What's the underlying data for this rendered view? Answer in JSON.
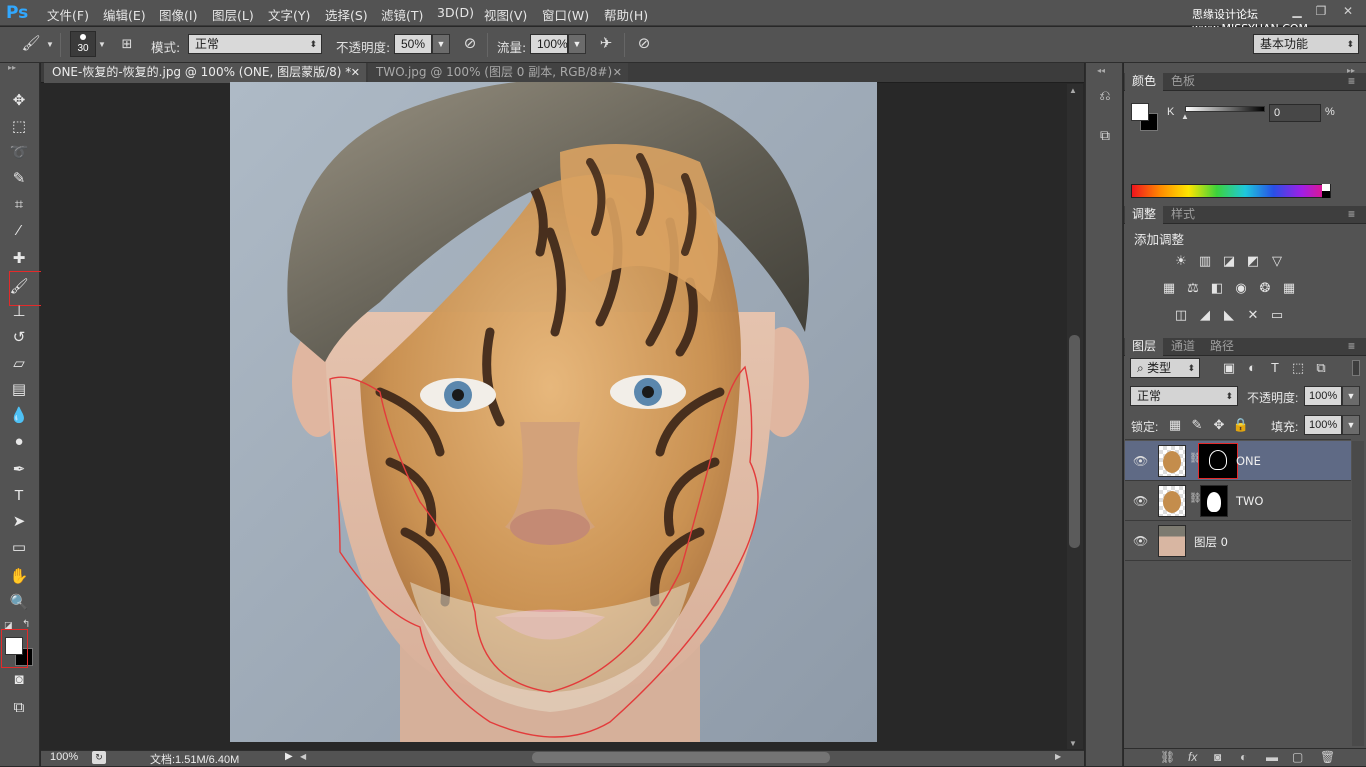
{
  "app": {
    "logo": "Ps"
  },
  "menu": [
    {
      "label": "文件(F)"
    },
    {
      "label": "编辑(E)"
    },
    {
      "label": "图像(I)"
    },
    {
      "label": "图层(L)"
    },
    {
      "label": "文字(Y)"
    },
    {
      "label": "选择(S)"
    },
    {
      "label": "滤镜(T)"
    },
    {
      "label": "3D(D)"
    },
    {
      "label": "视图(V)"
    },
    {
      "label": "窗口(W)"
    },
    {
      "label": "帮助(H)"
    }
  ],
  "watermark": "思缘设计论坛 www.MISSYUAN.COM",
  "options": {
    "brush_size": "30",
    "mode_label": "模式:",
    "mode_value": "正常",
    "opacity_label": "不透明度:",
    "opacity_value": "50%",
    "flow_label": "流量:",
    "flow_value": "100%",
    "workspace": "基本功能"
  },
  "tabs": [
    {
      "label": "ONE-恢复的-恢复的.jpg @ 100% (ONE, 图层蒙版/8) *"
    },
    {
      "label": "TWO.jpg @ 100% (图层 0 副本, RGB/8#) *"
    }
  ],
  "status": {
    "zoom": "100%",
    "doc": "文档:1.51M/6.40M"
  },
  "color_panel": {
    "tabs": [
      {
        "label": "颜色"
      },
      {
        "label": "色板"
      }
    ],
    "channel": "K",
    "value": "0",
    "unit": "%"
  },
  "adjust_panel": {
    "tabs": [
      {
        "label": "调整"
      },
      {
        "label": "样式"
      }
    ],
    "title": "添加调整"
  },
  "layers_panel": {
    "tabs": [
      {
        "label": "图层"
      },
      {
        "label": "通道"
      },
      {
        "label": "路径"
      }
    ],
    "filter": "类型",
    "blend_mode": "正常",
    "opacity_label": "不透明度:",
    "opacity_value": "100%",
    "lock_label": "锁定:",
    "fill_label": "填充:",
    "fill_value": "100%",
    "layers": [
      {
        "name": "ONE",
        "selected": true
      },
      {
        "name": "TWO",
        "selected": false
      },
      {
        "name": "图层 0",
        "selected": false
      }
    ]
  },
  "colors": {
    "accent_red": "#e42a2a",
    "ps_blue": "#31a8ff",
    "selected_layer": "#5f6a85"
  }
}
